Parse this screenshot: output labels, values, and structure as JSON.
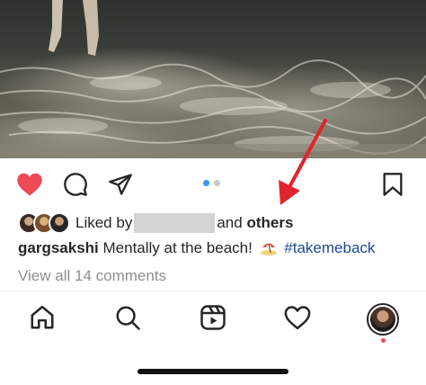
{
  "post": {
    "liked_prefix": "Liked by",
    "liked_and": "and",
    "liked_others": "others",
    "username": "gargsakshi",
    "caption_text": "Mentally at the beach!",
    "hashtag": "#takemeback",
    "view_comments": "View all 14 comments",
    "carousel": {
      "count": 2,
      "active_index": 0
    },
    "liked": true
  },
  "icons": {
    "like": "heart-filled-icon",
    "comment": "comment-bubble-icon",
    "share": "paper-plane-icon",
    "save": "bookmark-icon",
    "emoji": "beach-umbrella-emoji"
  },
  "bottom_nav": {
    "items": [
      "home-icon",
      "search-icon",
      "reels-icon",
      "activity-heart-icon",
      "profile-avatar"
    ]
  },
  "colors": {
    "like": "#ed4956",
    "hashtag": "#1d4b8f",
    "muted": "#8e8e8e",
    "carousel_active": "#3897f0",
    "annotation_arrow": "#e0242b"
  }
}
